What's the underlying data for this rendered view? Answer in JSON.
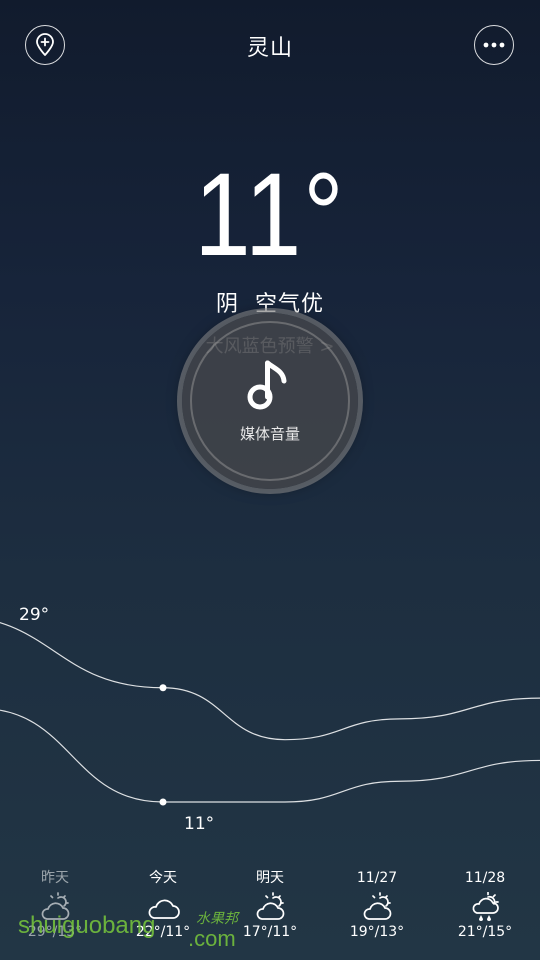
{
  "header": {
    "city": "灵山",
    "add_icon": "location-add-icon",
    "more_icon": "more-dots-icon"
  },
  "current": {
    "temperature": "11°",
    "condition": "阴",
    "air_quality": "空气优",
    "warning": "大风蓝色预警 >"
  },
  "volume_overlay": {
    "icon": "music-note-icon",
    "label": "媒体音量"
  },
  "chart": {
    "high_label": "29°",
    "low_label": "11°"
  },
  "chart_data": {
    "type": "line",
    "categories": [
      "昨天",
      "今天",
      "明天",
      "11/27",
      "11/28"
    ],
    "series": [
      {
        "values": [
          29,
          22,
          17,
          19,
          21
        ]
      },
      {
        "values": [
          null,
          11,
          11,
          13,
          15
        ]
      }
    ]
  },
  "forecast": [
    {
      "day": "昨天",
      "icon": "partly-cloudy-icon",
      "temp": "29°/13°",
      "dim": true
    },
    {
      "day": "今天",
      "icon": "cloudy-icon",
      "temp": "22°/11°",
      "dim": false
    },
    {
      "day": "明天",
      "icon": "partly-cloudy-icon",
      "temp": "17°/11°",
      "dim": false
    },
    {
      "day": "11/27",
      "icon": "partly-cloudy-icon",
      "temp": "19°/13°",
      "dim": false
    },
    {
      "day": "11/28",
      "icon": "rain-cloud-icon",
      "temp": "21°/15°",
      "dim": false
    }
  ],
  "watermark": {
    "main": "shuiguobang",
    "sub": "水果邦",
    "com": ".com"
  },
  "colors": {
    "bg_top": "#111b2d",
    "bg_bottom": "#223645",
    "watermark": "#78c83c"
  }
}
